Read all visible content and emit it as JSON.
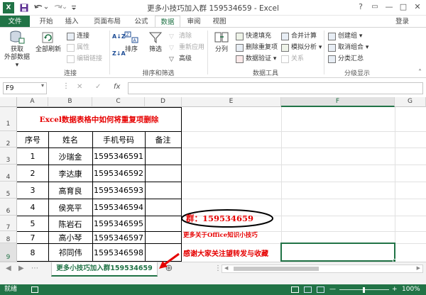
{
  "window": {
    "title": "更多小技巧加入群 159534659 - Excel",
    "controls": {
      "help": "?",
      "restore": "▭",
      "minimize": "—",
      "maximize": "□",
      "close": "✕"
    }
  },
  "quick_access": {
    "save": "save-icon",
    "undo": "undo-icon",
    "redo": "redo-icon"
  },
  "ribbon_tabs": [
    "文件",
    "开始",
    "插入",
    "页面布局",
    "公式",
    "数据",
    "审阅",
    "视图"
  ],
  "active_tab": "数据",
  "login_label": "登录",
  "ribbon": {
    "get_external_data": "获取\n外部数据▾",
    "refresh_all": "全部刷新",
    "connections": "连接",
    "properties": "属性",
    "edit_links": "编辑链接",
    "group_connections": "连接",
    "sort_az": "A↓Z",
    "sort_za": "Z↓A",
    "sort": "排序",
    "filter": "筛选",
    "clear": "清除",
    "reapply": "重新应用",
    "advanced": "高级",
    "group_sort_filter": "排序和筛选",
    "text_to_columns": "分列",
    "flash_fill": "快速填充",
    "remove_duplicates": "删除重复项",
    "data_validation": "数据验证 ▾",
    "consolidate": "合并计算",
    "what_if": "模拟分析 ▾",
    "relationships": "关系",
    "group_data_tools": "数据工具",
    "group": "创建组 ▾",
    "ungroup": "取消组合 ▾",
    "subtotal": "分类汇总",
    "group_outline": "分级显示"
  },
  "formula_bar": {
    "cell_ref": "F9",
    "cancel": "✕",
    "enter": "✓",
    "fx": "fx",
    "value": ""
  },
  "columns": [
    "A",
    "B",
    "C",
    "D",
    "E",
    "F",
    "G"
  ],
  "rows": [
    "1",
    "2",
    "3",
    "4",
    "5",
    "6",
    "7",
    "8",
    "9"
  ],
  "sheet": {
    "title": "Excel数据表格中如何将重复项删除",
    "headers": [
      "序号",
      "姓名",
      "手机号码",
      "备注"
    ],
    "data_rows": [
      [
        "1",
        "沙瑞金",
        "1595346591",
        ""
      ],
      [
        "2",
        "李达康",
        "1595346592",
        ""
      ],
      [
        "3",
        "高育良",
        "1595346593",
        ""
      ],
      [
        "4",
        "侯亮平",
        "1595346594",
        ""
      ],
      [
        "5",
        "陈岩石",
        "1595346595",
        ""
      ],
      [
        "7",
        "高小琴",
        "1595346597",
        ""
      ],
      [
        "8",
        "祁同伟",
        "1595346598",
        ""
      ]
    ],
    "note_group": "群：159534659",
    "note_more": "更多关于Office知识小技巧",
    "note_thanks": "感谢大家关注望转发与收藏"
  },
  "sheet_tab": "更多小技巧加入群159534659",
  "status": {
    "ready": "就绪",
    "zoom": "100%",
    "zoom_minus": "—",
    "zoom_plus": "+"
  },
  "colors": {
    "excel_green": "#217346",
    "red_text": "#e60000"
  }
}
